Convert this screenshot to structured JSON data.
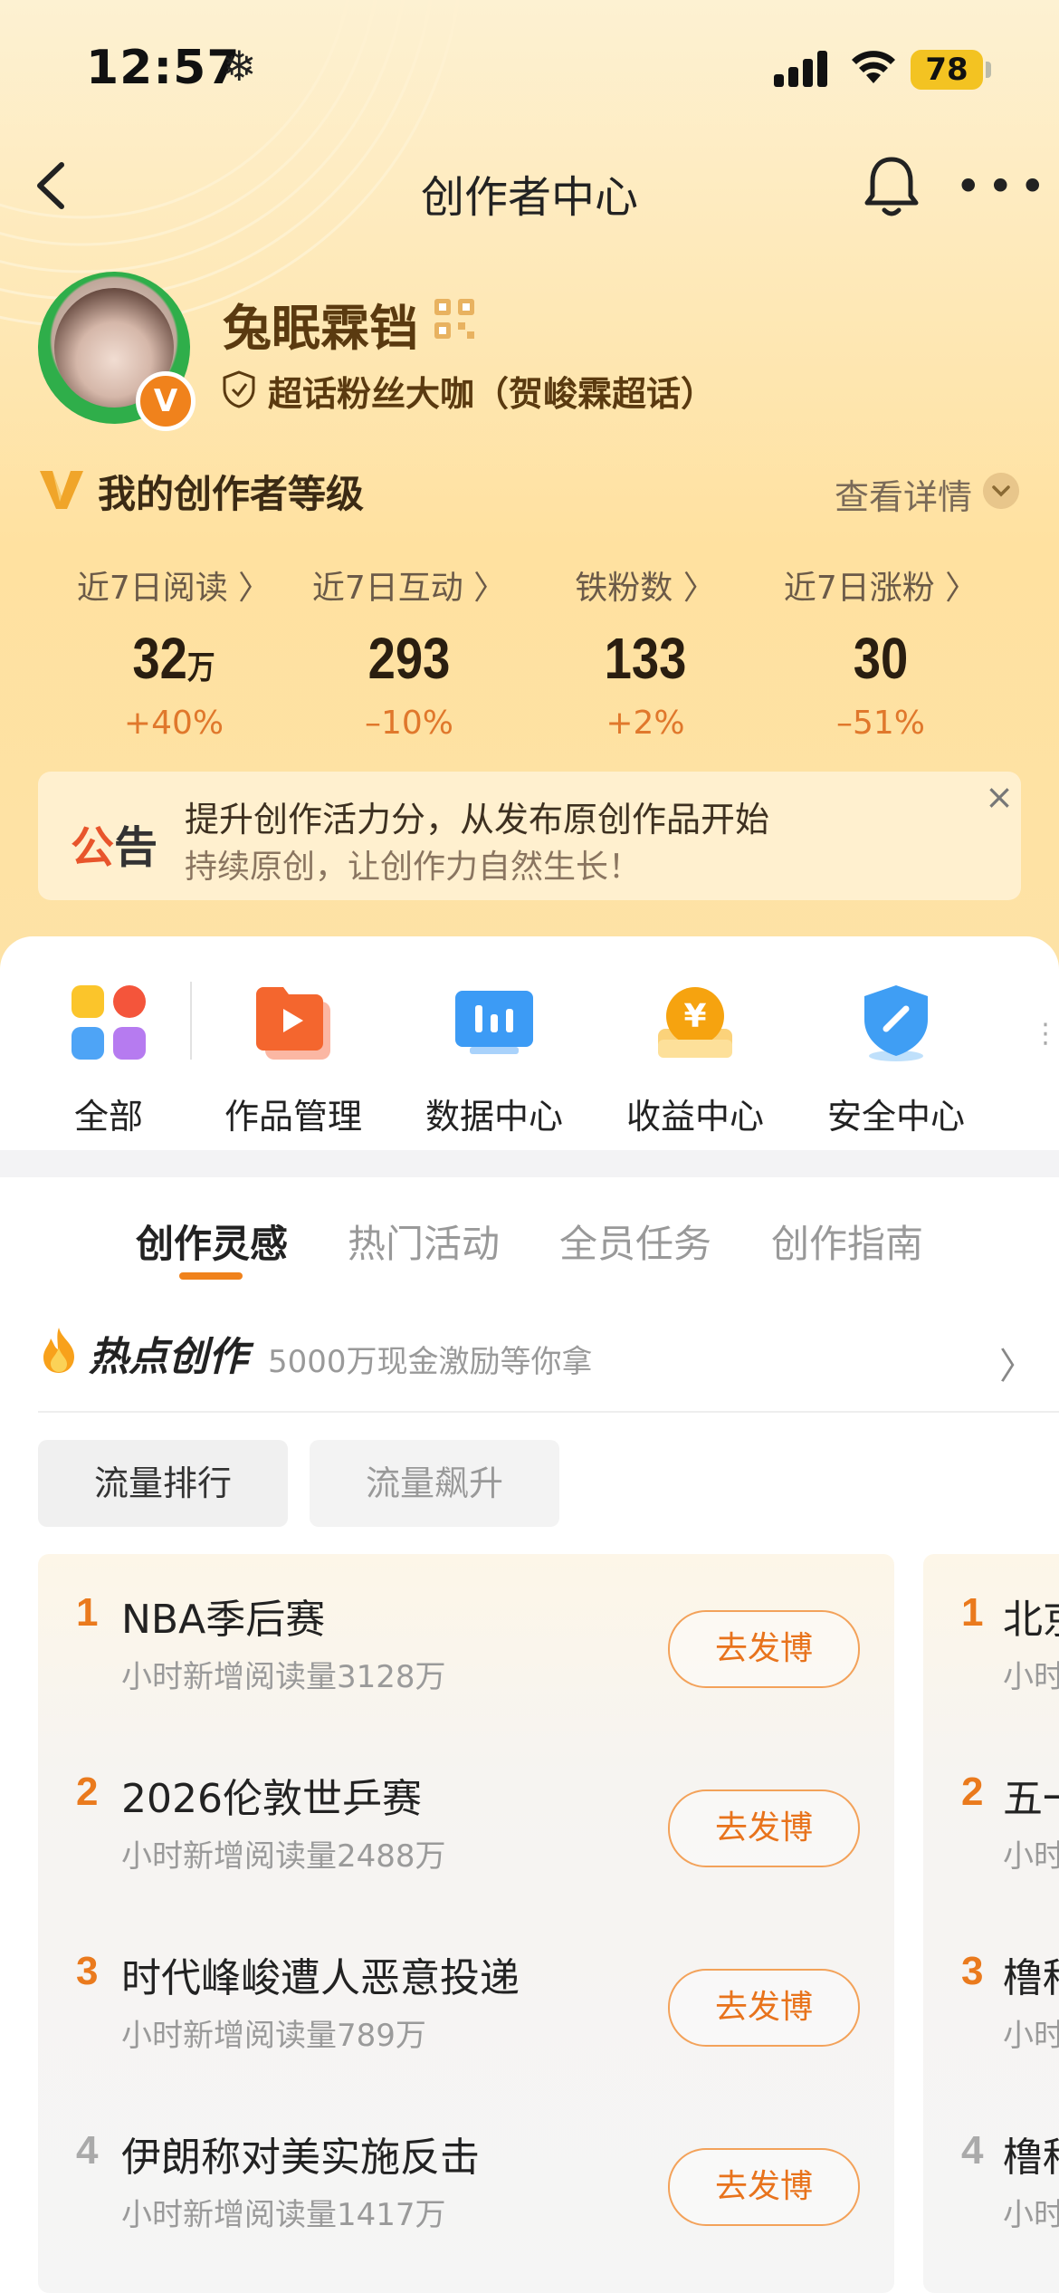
{
  "status_bar": {
    "time": "12:57",
    "weather_glyph": "❄",
    "battery": "78"
  },
  "nav": {
    "title": "创作者中心",
    "back_icon": "chevron-left-icon",
    "bell_icon": "bell-icon",
    "more_label": "•••"
  },
  "profile": {
    "name": "兔眠霖铛",
    "title": "超话粉丝大咖（贺峻霖超话）",
    "badge": "V"
  },
  "level": {
    "title": "我的创作者等级",
    "detail_link": "查看详情"
  },
  "stats": [
    {
      "label": "近7日阅读 〉",
      "value": "32",
      "unit": "万",
      "change": "+40%"
    },
    {
      "label": "近7日互动 〉",
      "value": "293",
      "unit": "",
      "change": "–10%"
    },
    {
      "label": "铁粉数 〉",
      "value": "133",
      "unit": "",
      "change": "+2%"
    },
    {
      "label": "近7日涨粉 〉",
      "value": "30",
      "unit": "",
      "change": "–51%"
    }
  ],
  "notice": {
    "tag_left": "公",
    "tag_right": "告",
    "line1": "提升创作活力分，从发布原创作品开始",
    "line2": "持续原创，让创作力自然生长！",
    "close": "×"
  },
  "tools": [
    {
      "label": "全部",
      "icon": "grid-apps-icon"
    },
    {
      "label": "作品管理",
      "icon": "play-folder-icon"
    },
    {
      "label": "数据中心",
      "icon": "bar-chart-monitor-icon"
    },
    {
      "label": "收益中心",
      "icon": "yuan-coin-icon"
    },
    {
      "label": "安全中心",
      "icon": "shield-check-icon"
    }
  ],
  "tabs": [
    {
      "label": "创作灵感",
      "active": true
    },
    {
      "label": "热门活动",
      "active": false
    },
    {
      "label": "全员任务",
      "active": false
    },
    {
      "label": "创作指南",
      "active": false
    }
  ],
  "hot": {
    "title": "热点创作",
    "subtitle": "5000万现金激励等你拿"
  },
  "filters": [
    "流量排行",
    "流量飙升"
  ],
  "ranking": [
    {
      "rank": "1",
      "title": "NBA季后赛",
      "sub": "小时新增阅读量3128万",
      "button": "去发博"
    },
    {
      "rank": "2",
      "title": "2026伦敦世乒赛",
      "sub": "小时新增阅读量2488万",
      "button": "去发博"
    },
    {
      "rank": "3",
      "title": "时代峰峻遭人恶意投递",
      "sub": "小时新增阅读量789万",
      "button": "去发博"
    },
    {
      "rank": "4",
      "title": "伊朗称对美实施反击",
      "sub": "小时新增阅读量1417万",
      "button": "去发博"
    }
  ],
  "ranking_next": [
    {
      "rank": "1",
      "title": "北京",
      "sub": "小时"
    },
    {
      "rank": "2",
      "title": "五一",
      "sub": "小时"
    },
    {
      "rank": "3",
      "title": "橹种",
      "sub": "小时"
    },
    {
      "rank": "4",
      "title": "橹种",
      "sub": "小时"
    }
  ],
  "colors": {
    "accent": "#f0821c",
    "rank": "#ea7a1d",
    "header_bg": "#ffe1a0"
  }
}
